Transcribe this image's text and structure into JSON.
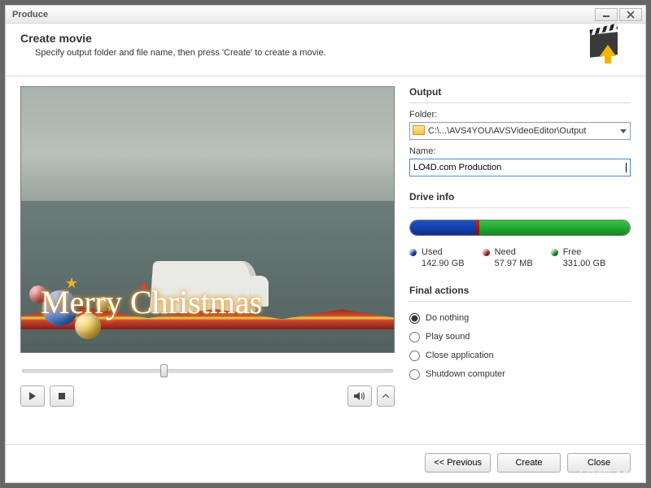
{
  "window": {
    "title": "Produce"
  },
  "header": {
    "title": "Create movie",
    "subtitle": "Specify output folder and file name, then press 'Create' to create a movie."
  },
  "preview": {
    "overlay_text": "Merry Christmas"
  },
  "playback": {
    "play_icon": "play-icon",
    "stop_icon": "stop-icon",
    "volume_icon": "volume-icon",
    "more_icon": "chevron-up-icon"
  },
  "output": {
    "section": "Output",
    "folder_label": "Folder:",
    "folder_value": "C:\\...\\AVS4YOU\\AVSVideoEditor\\Output",
    "name_label": "Name:",
    "name_value": "LO4D.com Production"
  },
  "drive": {
    "section": "Drive info",
    "used": {
      "label": "Used",
      "value": "142.90 GB",
      "percent": 30
    },
    "need": {
      "label": "Need",
      "value": "57.97 MB"
    },
    "free": {
      "label": "Free",
      "value": "331.00 GB"
    }
  },
  "final": {
    "section": "Final actions",
    "options": [
      "Do nothing",
      "Play sound",
      "Close application",
      "Shutdown computer"
    ],
    "selected": 0
  },
  "buttons": {
    "previous": "<< Previous",
    "create": "Create",
    "close": "Close"
  },
  "watermark": "LO4D.com"
}
